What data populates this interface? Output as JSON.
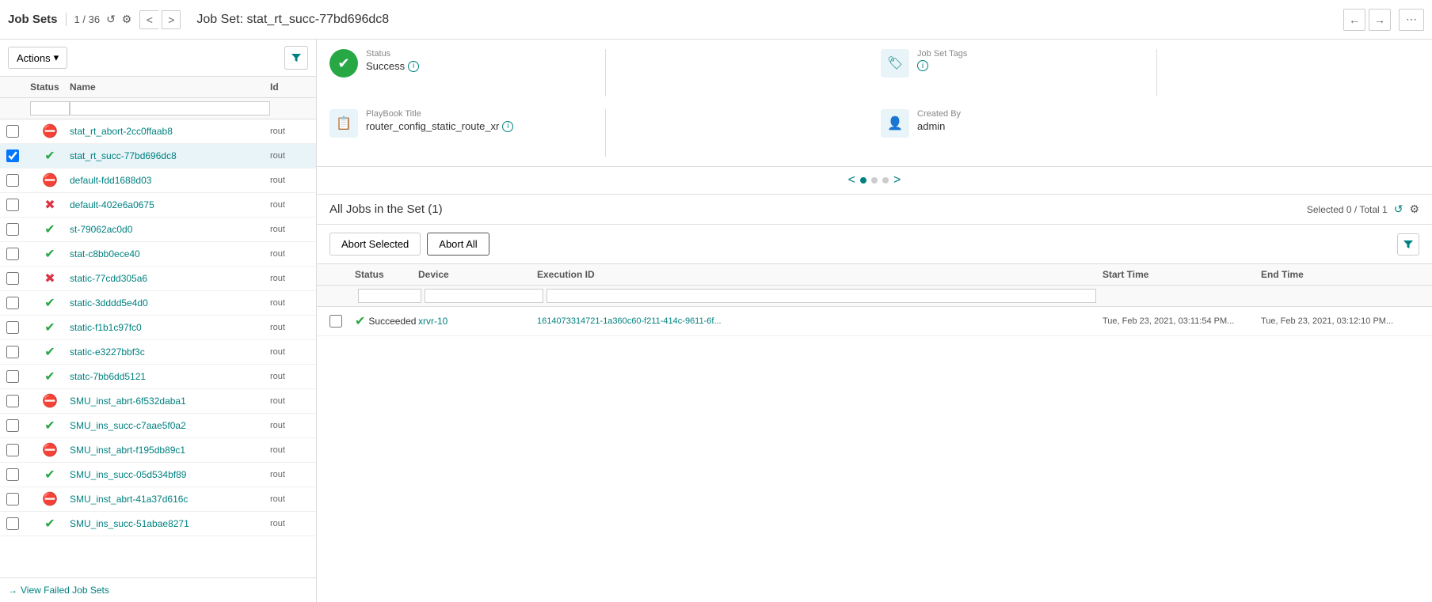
{
  "header": {
    "title": "Job Sets",
    "pagination": "1 / 36"
  },
  "left_panel": {
    "actions_label": "Actions",
    "columns": {
      "status": "Status",
      "name": "Name",
      "id": "Id"
    },
    "rows": [
      {
        "status": "abort",
        "name": "stat_rt_abort-2cc0ffaab8",
        "id": "rout",
        "selected": false
      },
      {
        "status": "success",
        "name": "stat_rt_succ-77bd696dc8",
        "id": "rout",
        "selected": true
      },
      {
        "status": "abort",
        "name": "default-fdd1688d03",
        "id": "rout",
        "selected": false
      },
      {
        "status": "error",
        "name": "default-402e6a0675",
        "id": "rout",
        "selected": false
      },
      {
        "status": "success",
        "name": "st-79062ac0d0",
        "id": "rout",
        "selected": false
      },
      {
        "status": "success",
        "name": "stat-c8bb0ece40",
        "id": "rout",
        "selected": false
      },
      {
        "status": "error",
        "name": "static-77cdd305a6",
        "id": "rout",
        "selected": false
      },
      {
        "status": "success",
        "name": "static-3dddd5e4d0",
        "id": "rout",
        "selected": false
      },
      {
        "status": "success",
        "name": "static-f1b1c97fc0",
        "id": "rout",
        "selected": false
      },
      {
        "status": "success",
        "name": "static-e3227bbf3c",
        "id": "rout",
        "selected": false
      },
      {
        "status": "success",
        "name": "statc-7bb6dd5121",
        "id": "rout",
        "selected": false
      },
      {
        "status": "abort",
        "name": "SMU_inst_abrt-6f532daba1",
        "id": "rout",
        "selected": false
      },
      {
        "status": "success",
        "name": "SMU_ins_succ-c7aae5f0a2",
        "id": "rout",
        "selected": false
      },
      {
        "status": "abort",
        "name": "SMU_inst_abrt-f195db89c1",
        "id": "rout",
        "selected": false
      },
      {
        "status": "success",
        "name": "SMU_ins_succ-05d534bf89",
        "id": "rout",
        "selected": false
      },
      {
        "status": "abort",
        "name": "SMU_inst_abrt-41a37d616c",
        "id": "rout",
        "selected": false
      },
      {
        "status": "success",
        "name": "SMU_ins_succ-51abae8271",
        "id": "rout",
        "selected": false
      }
    ],
    "view_failed_label": "View Failed Job Sets"
  },
  "right_panel": {
    "title": "Job Set: stat_rt_succ-77bd696dc8",
    "info_cards": {
      "status": {
        "label": "Status",
        "value": "Success"
      },
      "tags": {
        "label": "Job Set Tags"
      },
      "playbook": {
        "label": "PlayBook Title",
        "value": "router_config_static_route_xr"
      },
      "created_by": {
        "label": "Created By",
        "value": "admin"
      }
    },
    "jobs_section": {
      "title": "All Jobs in the Set (1)",
      "selected_total": "Selected 0 / Total 1",
      "abort_selected_label": "Abort Selected",
      "abort_all_label": "Abort All",
      "table_columns": {
        "status": "Status",
        "device": "Device",
        "execution_id": "Execution ID",
        "start_time": "Start Time",
        "end_time": "End Time"
      },
      "rows": [
        {
          "status": "Succeeded",
          "device": "xrvr-10",
          "execution_id": "1614073314721-1a360c60-f211-414c-9611-6f...",
          "start_time": "Tue, Feb 23, 2021, 03:11:54 PM...",
          "end_time": "Tue, Feb 23, 2021, 03:12:10 PM..."
        }
      ]
    }
  }
}
